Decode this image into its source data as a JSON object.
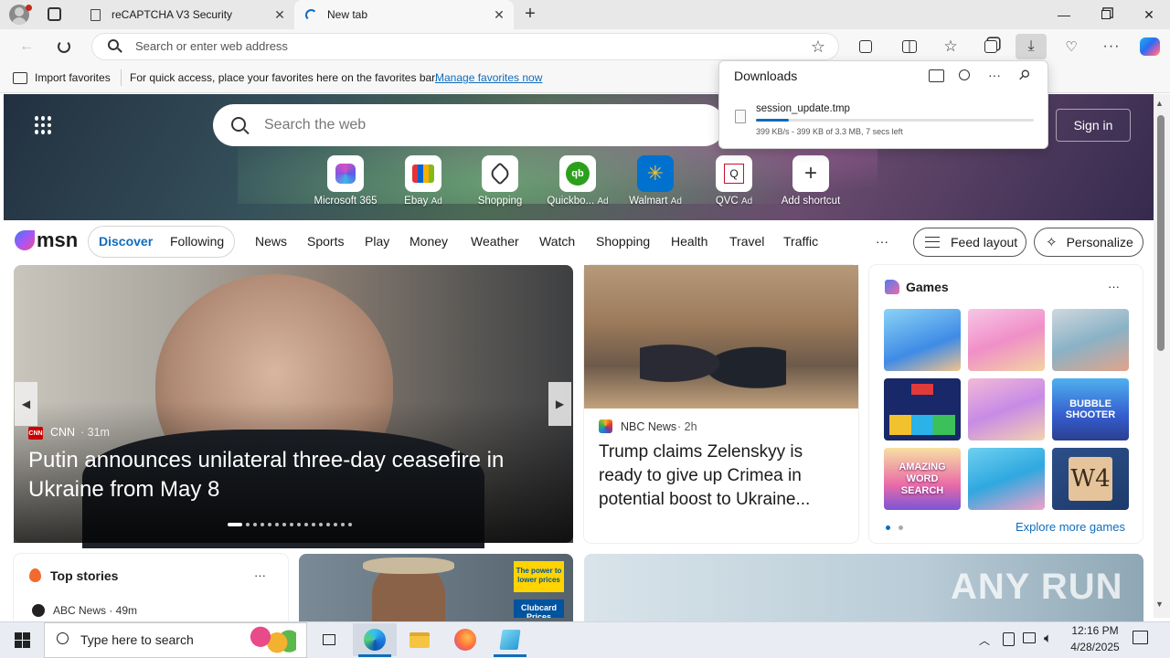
{
  "colors": {
    "accent": "#0f6cbd",
    "msn_blue": "#1a73e8",
    "progress": "#0f6cbd"
  },
  "browser": {
    "tabs": [
      {
        "title": "reCAPTCHA V3 Security",
        "icon": "page-icon"
      },
      {
        "title": "New tab",
        "icon": "loading-icon",
        "active": true
      }
    ],
    "address": {
      "placeholder": "Search or enter web address",
      "value": ""
    },
    "toolbar_icons": [
      "favorite-star-icon",
      "extensions-icon",
      "split-screen-icon",
      "favorites-icon",
      "collections-icon",
      "downloads-icon",
      "browser-essentials-icon",
      "more-icon",
      "copilot-icon"
    ]
  },
  "favorites_bar": {
    "import_label": "Import favorites",
    "hint": "For quick access, place your favorites here on the favorites bar.",
    "manage_link": "Manage favorites now"
  },
  "downloads": {
    "title": "Downloads",
    "file_name": "session_update.tmp",
    "status": "399 KB/s - 399 KB of 3.3 MB, 7 secs left",
    "progress_fraction": 0.12
  },
  "newtab": {
    "search_placeholder": "Search the web",
    "signin_label": "Sign in",
    "shortcuts": [
      {
        "label": "Microsoft 365",
        "ad": ""
      },
      {
        "label": "Ebay",
        "ad": "Ad"
      },
      {
        "label": "Shopping",
        "ad": ""
      },
      {
        "label": "Quickbo...",
        "ad": "Ad"
      },
      {
        "label": "Walmart",
        "ad": "Ad"
      },
      {
        "label": "QVC",
        "ad": "Ad"
      },
      {
        "label": "Add shortcut",
        "ad": ""
      }
    ]
  },
  "msn": {
    "logo": "msn",
    "tabs": [
      "Discover",
      "Following"
    ],
    "nav": [
      "News",
      "Sports",
      "Play",
      "Money",
      "Weather",
      "Watch",
      "Shopping",
      "Health",
      "Travel",
      "Traffic"
    ],
    "more": "···",
    "feed_layout": "Feed layout",
    "personalize": "Personalize"
  },
  "main_story": {
    "source": "CNN",
    "time": "· 31m",
    "headline": "Putin announces unilateral three-day ceasefire in Ukraine from May 8"
  },
  "story2": {
    "source": "NBC News",
    "time": "· 2h",
    "headline": "Trump claims Zelenskyy is ready to give up Crimea in potential boost to Ukraine..."
  },
  "games": {
    "title": "Games",
    "more": "···",
    "explore": "Explore more games",
    "tile_text": [
      "BUBBLE SHOOTER",
      "AMAZING WORD SEARCH",
      "W4"
    ]
  },
  "top_stories": {
    "title": "Top stories",
    "more": "···",
    "first_source": "ABC News · 49m"
  },
  "ad_card": {
    "text1": "The power to lower prices",
    "text2": "Clubcard Prices"
  },
  "watermark": "ANY RUN",
  "taskbar": {
    "search_placeholder": "Type here to search",
    "time": "12:16 PM",
    "date": "4/28/2025"
  }
}
